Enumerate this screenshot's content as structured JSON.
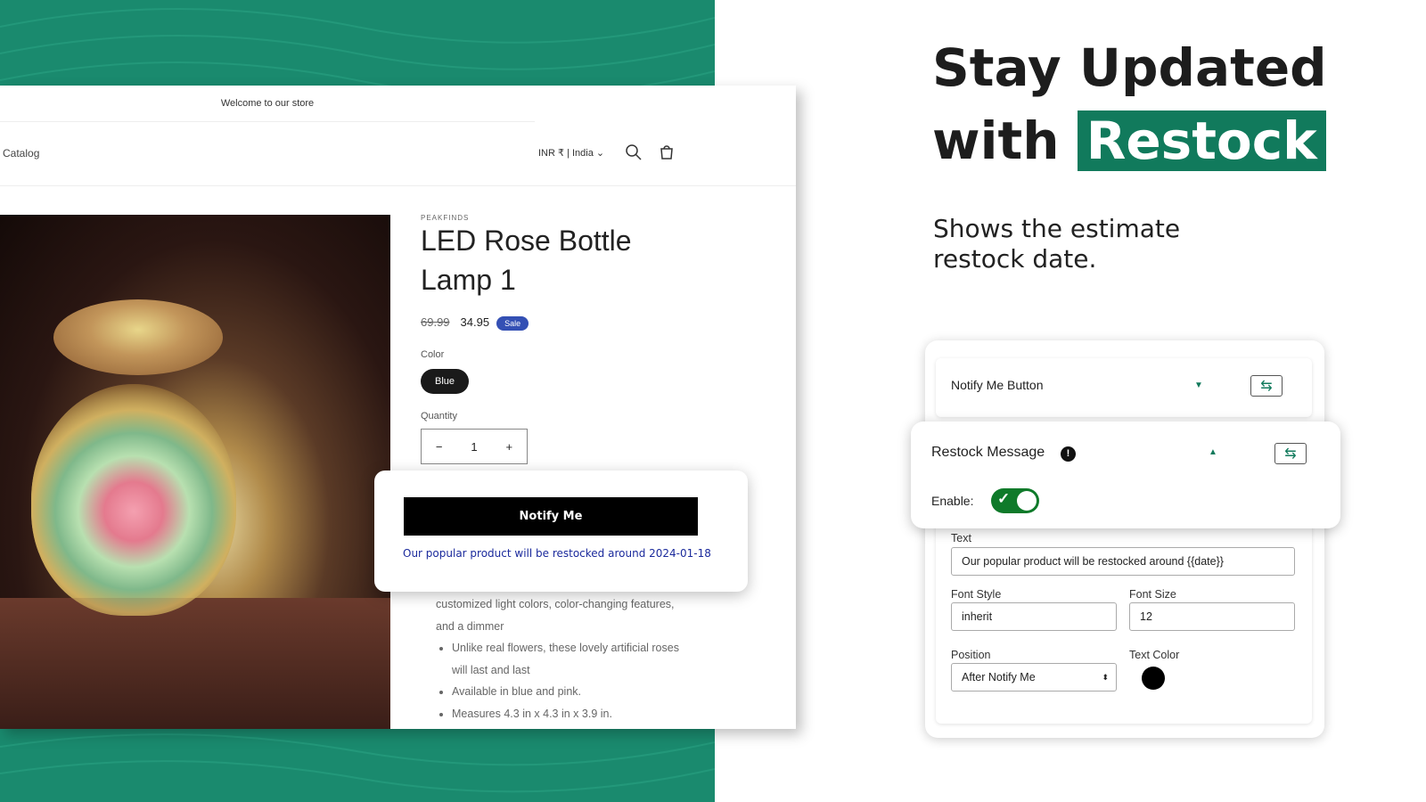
{
  "colors": {
    "brand": "#1a8a6e",
    "highlight": "#117a5c",
    "sale": "#3450b4",
    "toggle": "#0f7a2a",
    "message": "#1b2a9c"
  },
  "store": {
    "announcement": "Welcome to our store",
    "nav": {
      "catalog": "Catalog",
      "currency": "INR ₹ | India",
      "icons": [
        "search-icon",
        "cart-icon"
      ]
    },
    "product": {
      "vendor": "PEAKFINDS",
      "title": "LED Rose Bottle Lamp 1",
      "old_price": "69.99",
      "price": "34.95",
      "badge": "Sale",
      "color_label": "Color",
      "color_value": "Blue",
      "quantity_label": "Quantity",
      "quantity": "1",
      "description": [
        "customized light colors, color-changing features, and a dimmer",
        "Unlike real flowers, these lovely artificial roses will last and last",
        "Available in blue and pink.",
        "Measures 4.3 in x 4.3 in x 3.9 in."
      ]
    },
    "popup": {
      "button": "Notify Me",
      "message": "Our popular product will be restocked around 2024-01-18"
    }
  },
  "hero": {
    "line1": "Stay Updated",
    "line2_prefix": "with",
    "line2_highlight": "Restock",
    "subtitle": "Shows the estimate restock date."
  },
  "settings": {
    "notify_section": "Notify Me Button",
    "restock_section": "Restock Message",
    "enable_label": "Enable:",
    "enabled": true,
    "text_label": "Text",
    "text_value": "Our popular product will be restocked around {{date}}",
    "font_style_label": "Font Style",
    "font_style": "inherit",
    "font_size_label": "Font Size",
    "font_size": "12",
    "position_label": "Position",
    "position": "After Notify Me",
    "text_color_label": "Text Color",
    "text_color": "#000000"
  }
}
